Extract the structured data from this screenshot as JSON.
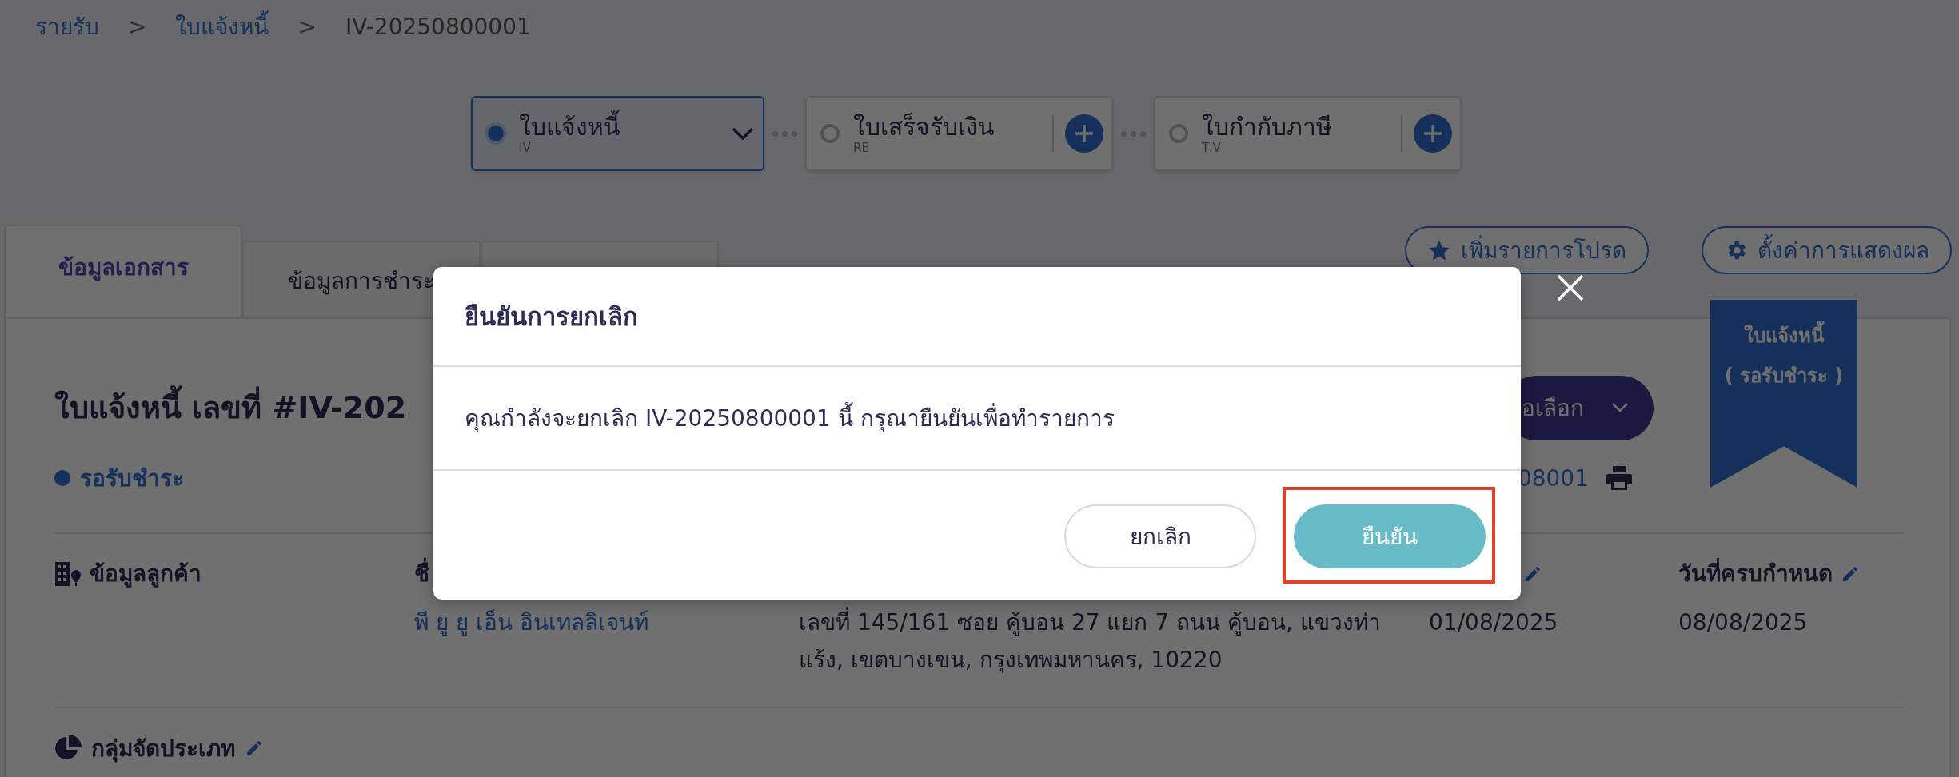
{
  "breadcrumb": [
    {
      "label": "รายรับ",
      "kind": "link"
    },
    {
      "label": ">",
      "kind": "separator"
    },
    {
      "label": "ใบแจ้งหนี้",
      "kind": "link"
    },
    {
      "label": ">",
      "kind": "separator"
    },
    {
      "label": "IV-20250800001",
      "kind": "current"
    }
  ],
  "document_steps": [
    {
      "title": "ใบแจ้งหนี้",
      "code": "IV",
      "selected": true,
      "kind": "dropdown"
    },
    {
      "title": "ใบเสร็จรับเงิน",
      "code": "RE",
      "selected": false,
      "kind": "add"
    },
    {
      "title": "ใบกำกับภาษี",
      "code": "TIV",
      "selected": false,
      "kind": "add"
    }
  ],
  "tabs": [
    {
      "label": "ข้อมูลเอกสาร",
      "selected": true
    },
    {
      "label": "ข้อมูลการชำระ",
      "selected": false
    },
    {
      "selected": false
    }
  ],
  "header_buttons": [
    {
      "label": "เพิ่มรายการโปรด",
      "kind": "favorite"
    },
    {
      "label": "ตั้งค่าการแสดงผล",
      "kind": "settings"
    }
  ],
  "ribbon": {
    "title": "ใบแจ้งหนี้",
    "status": "( รอรับชำระ )"
  },
  "document": {
    "title": "ใบแจ้งหนี้ เลขที่ #IV-202",
    "status": "รอรับชำระ",
    "options_button": "อเลือก",
    "reference": "08001"
  },
  "customer": {
    "section": "ข้อมูลลูกค้า",
    "name_label": "ชื่",
    "name": "พี ยู ยู เอ็น อินเทลลิเจนท์",
    "address_lines": [
      "เลขที่ 145/161 ซอย คู้บอน 27 แยก 7 ถนน คู้บอน, แขวงท่า",
      "แร้ง, เขตบางเขน, กรุงเทพมหานคร, 10220"
    ],
    "issue_date": "01/08/2025",
    "due_label": "วันที่ครบกำหนด",
    "due_date": "08/08/2025"
  },
  "category": {
    "section": "กลุ่มจัดประเภท"
  },
  "dialog": {
    "title": "ยืนยันการยกเลิก",
    "message": "คุณกำลังจะยกเลิก IV-20250800001 นี้ กรุณายืนยันเพื่อทำรายการ",
    "buttons": [
      {
        "label": "ยกเลิก",
        "kind": "secondary",
        "highlighted": false
      },
      {
        "label": "ยืนยัน",
        "kind": "primary",
        "highlighted": true
      }
    ]
  }
}
